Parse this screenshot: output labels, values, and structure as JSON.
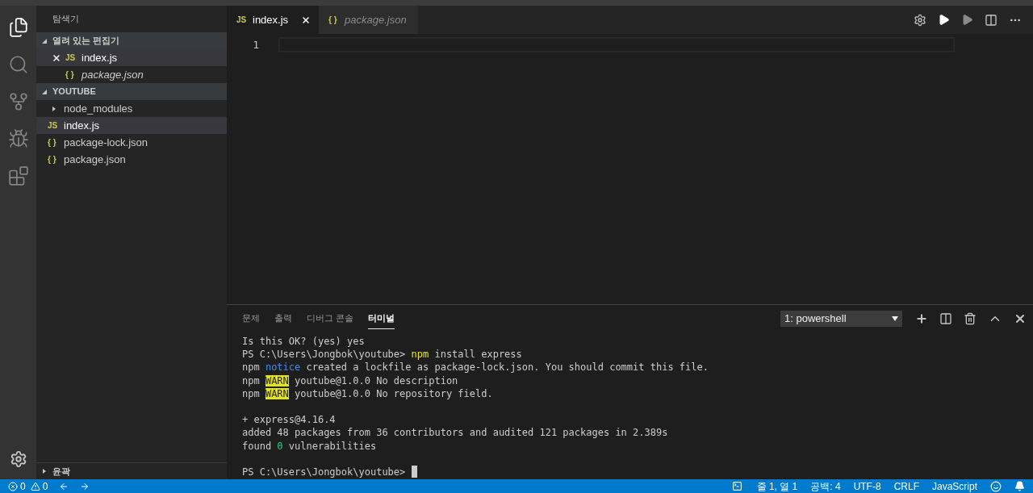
{
  "activity_bar": [
    {
      "kind": "files",
      "selected": true
    },
    {
      "kind": "search",
      "selected": false
    },
    {
      "kind": "source-control",
      "selected": false
    },
    {
      "kind": "debug",
      "selected": false
    },
    {
      "kind": "extensions",
      "selected": false
    }
  ],
  "sidebar": {
    "title": "탐색기",
    "open_editors": {
      "title": "열려 있는 편집기",
      "expanded": true,
      "items": [
        {
          "name": "index.js",
          "icon": "JS",
          "selected": true,
          "preview": false
        },
        {
          "name": "package.json",
          "icon": "{ }",
          "selected": false,
          "preview": true
        }
      ]
    },
    "project": {
      "title": "YOUTUBE",
      "expanded": true,
      "items": [
        {
          "name": "node_modules",
          "kind": "folder",
          "expanded": false,
          "selected": false
        },
        {
          "name": "index.js",
          "kind": "file",
          "icon": "JS",
          "selected": true
        },
        {
          "name": "package-lock.json",
          "kind": "file",
          "icon": "{ }",
          "selected": false
        },
        {
          "name": "package.json",
          "kind": "file",
          "icon": "{ }",
          "selected": false
        }
      ]
    },
    "outline": {
      "title": "윤곽",
      "expanded": false
    }
  },
  "editor": {
    "tabs": [
      {
        "name": "index.js",
        "icon": "JS",
        "selected": true,
        "preview": false
      },
      {
        "name": "package.json",
        "icon": "{ }",
        "selected": false,
        "preview": true
      }
    ],
    "line_numbers": [
      "1"
    ]
  },
  "panel": {
    "tabs": [
      {
        "label": "문제",
        "selected": false
      },
      {
        "label": "출력",
        "selected": false
      },
      {
        "label": "디버그 콘솔",
        "selected": false
      },
      {
        "label": "터미널",
        "selected": true
      }
    ],
    "terminal_select": "1: powershell",
    "terminal_lines": [
      {
        "kind": "text",
        "segments": [
          {
            "text": "Is this OK? (yes) yes",
            "kind": "plain"
          }
        ]
      },
      {
        "kind": "text",
        "segments": [
          {
            "text": "PS C:\\Users\\Jongbok\\youtube> ",
            "kind": "plain"
          },
          {
            "text": "npm",
            "kind": "command"
          },
          {
            "text": " install express",
            "kind": "plain"
          }
        ]
      },
      {
        "kind": "text",
        "segments": [
          {
            "text": "npm ",
            "kind": "plain"
          },
          {
            "text": "notice",
            "kind": "notice"
          },
          {
            "text": " created a lockfile as package-lock.json. You should commit this file.",
            "kind": "plain"
          }
        ]
      },
      {
        "kind": "text",
        "segments": [
          {
            "text": "npm ",
            "kind": "plain"
          },
          {
            "text": "WARN",
            "kind": "warning"
          },
          {
            "text": " youtube@1.0.0 No description",
            "kind": "plain"
          }
        ]
      },
      {
        "kind": "text",
        "segments": [
          {
            "text": "npm ",
            "kind": "plain"
          },
          {
            "text": "WARN",
            "kind": "warning"
          },
          {
            "text": " youtube@1.0.0 No repository field.",
            "kind": "plain"
          }
        ]
      },
      {
        "kind": "blank"
      },
      {
        "kind": "text",
        "segments": [
          {
            "text": "+ express@4.16.4",
            "kind": "plain"
          }
        ]
      },
      {
        "kind": "text",
        "segments": [
          {
            "text": "added 48 packages from 36 contributors and audited 121 packages in 2.389s",
            "kind": "plain"
          }
        ]
      },
      {
        "kind": "text",
        "segments": [
          {
            "text": "found ",
            "kind": "plain"
          },
          {
            "text": "0",
            "kind": "count"
          },
          {
            "text": " vulnerabilities",
            "kind": "plain"
          }
        ]
      },
      {
        "kind": "blank"
      },
      {
        "kind": "prompt",
        "segments": [
          {
            "text": "PS C:\\Users\\Jongbok\\youtube> ",
            "kind": "plain"
          }
        ]
      }
    ]
  },
  "status_bar": {
    "errors": "0",
    "warnings": "0",
    "items": [
      "줄 1, 열 1",
      "공백: 4",
      "UTF-8",
      "CRLF",
      "JavaScript"
    ]
  }
}
